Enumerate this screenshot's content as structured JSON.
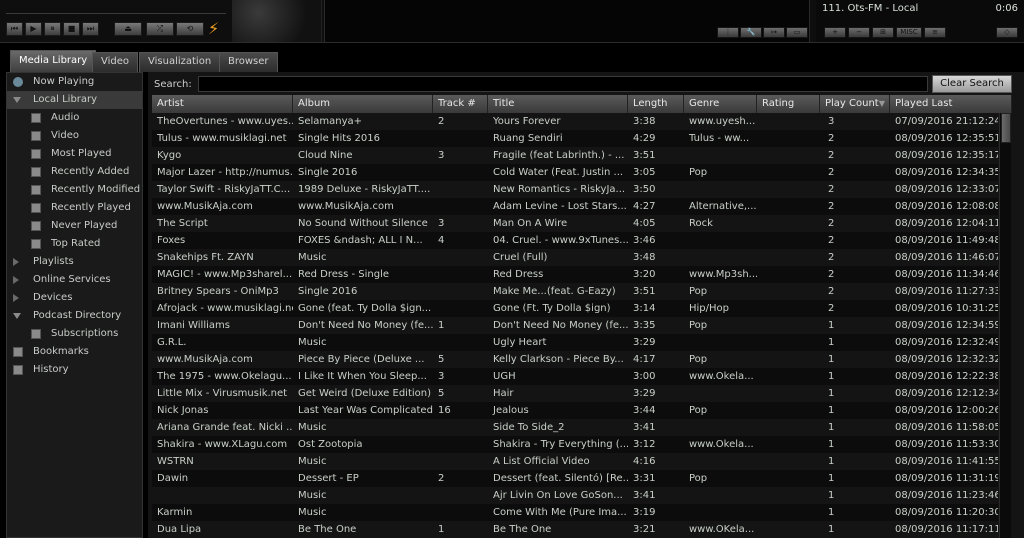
{
  "player": {
    "transport": {
      "prev": "⏮",
      "play": "▶",
      "pause": "⏸",
      "stop": "■",
      "next": "⏭",
      "eject": "⏏",
      "shuffle": "⤮",
      "repeat": "⟲"
    },
    "bolt": "⚡",
    "small_buttons": [
      "⋮",
      "🔧",
      "↦",
      "▭"
    ],
    "playlist_current": {
      "title": "111. Ots-FM - Local",
      "time": "0:06"
    },
    "playlist_buttons": [
      "+",
      "−",
      "⊞",
      "MISC",
      "≡"
    ]
  },
  "tabs": [
    "Media Library",
    "Video",
    "Visualization",
    "Browser"
  ],
  "active_tab": 0,
  "sidebar": {
    "items": [
      {
        "label": "Now Playing",
        "icon": "play-circle-icon",
        "level": 0
      },
      {
        "label": "Local Library",
        "icon": "expanded-arrow-icon",
        "level": 0,
        "selected": true
      },
      {
        "label": "Audio",
        "icon": "speaker-icon",
        "level": 1
      },
      {
        "label": "Video",
        "icon": "film-icon",
        "level": 1
      },
      {
        "label": "Most Played",
        "icon": "list-icon",
        "level": 1
      },
      {
        "label": "Recently Added",
        "icon": "list-icon",
        "level": 1
      },
      {
        "label": "Recently Modified",
        "icon": "list-icon",
        "level": 1
      },
      {
        "label": "Recently Played",
        "icon": "list-icon",
        "level": 1
      },
      {
        "label": "Never Played",
        "icon": "list-icon",
        "level": 1
      },
      {
        "label": "Top Rated",
        "icon": "star-icon",
        "level": 1
      },
      {
        "label": "Playlists",
        "icon": "collapsed-arrow-icon",
        "level": 0
      },
      {
        "label": "Online Services",
        "icon": "collapsed-arrow-icon",
        "level": 0
      },
      {
        "label": "Devices",
        "icon": "collapsed-arrow-icon",
        "level": 0
      },
      {
        "label": "Podcast Directory",
        "icon": "expanded-arrow-icon",
        "level": 0
      },
      {
        "label": "Subscriptions",
        "icon": "folder-icon",
        "level": 1
      },
      {
        "label": "Bookmarks",
        "icon": "bookmark-icon",
        "level": 0
      },
      {
        "label": "History",
        "icon": "history-icon",
        "level": 0
      }
    ]
  },
  "search": {
    "label": "Search:",
    "value": "",
    "clear_label": "Clear Search"
  },
  "table": {
    "columns": [
      "Artist",
      "Album",
      "Track #",
      "Title",
      "Length",
      "Genre",
      "Rating",
      "Play Count",
      "Played Last"
    ],
    "sort_icon": "▼",
    "rows": [
      [
        "TheOvertunes - www.uyes...",
        "Selamanya+",
        "2",
        "Yours Forever",
        "3:38",
        "www.uyesh...",
        "",
        "3",
        "07/09/2016 21:12:24"
      ],
      [
        "Tulus - www.musiklagi.net",
        "Single Hits 2016",
        "",
        "Ruang Sendiri",
        "4:29",
        "Tulus - ww...",
        "",
        "2",
        "08/09/2016 12:35:51"
      ],
      [
        "Kygo",
        "Cloud Nine",
        "3",
        "Fragile (feat Labrinth.) - ...",
        "3:51",
        "",
        "",
        "2",
        "08/09/2016 12:35:17"
      ],
      [
        "Major Lazer - http://numus...",
        "Single 2016",
        "",
        "Cold Water (Feat. Justin ...",
        "3:05",
        "Pop",
        "",
        "2",
        "08/09/2016 12:34:35"
      ],
      [
        "Taylor Swift - RiskyJaTT.C...",
        "1989 Deluxe - RiskyJaTT....",
        "",
        "New Romantics - RiskyJa...",
        "3:50",
        "",
        "",
        "2",
        "08/09/2016 12:33:07"
      ],
      [
        "www.MusikAja.com",
        "www.MusikAja.com",
        "",
        "Adam Levine - Lost Stars...",
        "4:27",
        "Alternative,...",
        "",
        "2",
        "08/09/2016 12:08:08"
      ],
      [
        "The Script",
        "No Sound Without Silence",
        "3",
        "Man On A Wire",
        "4:05",
        "Rock",
        "",
        "2",
        "08/09/2016 12:04:11"
      ],
      [
        "Foxes",
        "FOXES &ndash; ALL I N...",
        "4",
        "04. Cruel. - www.9xTunes...",
        "3:46",
        "",
        "",
        "2",
        "08/09/2016 11:49:48"
      ],
      [
        "Snakehips Ft. ZAYN",
        "Music",
        "",
        "Cruel (Full)",
        "3:48",
        "",
        "",
        "2",
        "08/09/2016 11:46:07"
      ],
      [
        "MAGIC! - www.Mp3sharel...",
        "Red Dress - Single",
        "",
        "Red Dress",
        "3:20",
        "www.Mp3sh...",
        "",
        "2",
        "08/09/2016 11:34:46"
      ],
      [
        "Britney Spears - OniMp3",
        "Single 2016",
        "",
        "Make Me...(feat. G-Eazy)",
        "3:51",
        "Pop",
        "",
        "2",
        "08/09/2016 11:27:33"
      ],
      [
        "Afrojack - www.musiklagi.net",
        "Gone (feat. Ty Dolla $ign...",
        "",
        "Gone (Ft. Ty Dolla $ign)",
        "3:14",
        "Hip/Hop",
        "",
        "2",
        "08/09/2016 10:31:25"
      ],
      [
        "Imani Williams",
        "Don't Need No Money (fe...",
        "1",
        "Don't Need No Money (fe...",
        "3:35",
        "Pop",
        "",
        "1",
        "08/09/2016 12:34:59"
      ],
      [
        "G.R.L.",
        "Music",
        "",
        "Ugly Heart",
        "3:29",
        "",
        "",
        "1",
        "08/09/2016 12:32:49"
      ],
      [
        "www.MusikAja.com",
        "Piece By Piece (Deluxe ...",
        "5",
        "Kelly Clarkson - Piece By...",
        "4:17",
        "Pop",
        "",
        "1",
        "08/09/2016 12:32:32"
      ],
      [
        "The 1975 - www.Okelagu...",
        "I Like It When You Sleep...",
        "3",
        "UGH",
        "3:00",
        "www.Okela...",
        "",
        "1",
        "08/09/2016 12:22:38"
      ],
      [
        "Little Mix - Virusmusik.net",
        "Get Weird (Deluxe Edition)",
        "5",
        "Hair",
        "3:29",
        "",
        "",
        "1",
        "08/09/2016 12:12:34"
      ],
      [
        "Nick Jonas",
        "Last Year Was Complicated",
        "16",
        "Jealous",
        "3:44",
        "Pop",
        "",
        "1",
        "08/09/2016 12:00:26"
      ],
      [
        "Ariana Grande feat. Nicki ...",
        "Music",
        "",
        "Side To Side_2",
        "3:41",
        "",
        "",
        "1",
        "08/09/2016 11:58:05"
      ],
      [
        "Shakira - www.XLagu.com",
        "Ost Zootopia",
        "",
        "Shakira - Try Everything (...",
        "3:12",
        "www.Okela...",
        "",
        "1",
        "08/09/2016 11:53:30"
      ],
      [
        "WSTRN",
        "Music",
        "",
        "A List Official Video",
        "4:16",
        "",
        "",
        "1",
        "08/09/2016 11:41:55"
      ],
      [
        "Dawin",
        "Dessert - EP",
        "2",
        "Dessert (feat. Silentó) [Re...",
        "3:31",
        "Pop",
        "",
        "1",
        "08/09/2016 11:31:19"
      ],
      [
        "",
        "Music",
        "",
        "Ajr Livin On Love GoSon...",
        "3:41",
        "",
        "",
        "1",
        "08/09/2016 11:23:46"
      ],
      [
        "Karmin",
        "Music",
        "",
        "Come With Me (Pure Ima...",
        "3:19",
        "",
        "",
        "1",
        "08/09/2016 11:20:30"
      ],
      [
        "Dua Lipa",
        "Be The One",
        "1",
        "Be The One",
        "3:21",
        "www.OKela...",
        "",
        "1",
        "08/09/2016 11:17:11"
      ]
    ]
  }
}
